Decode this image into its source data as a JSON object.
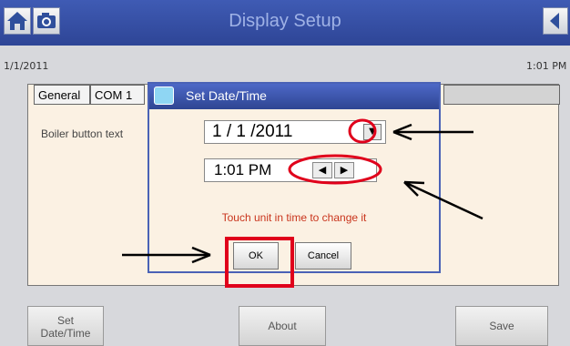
{
  "window": {
    "title": "Display Setup"
  },
  "toolbar": {
    "home_icon": "home-icon",
    "camera_icon": "camera-icon",
    "back_icon": "back-icon"
  },
  "status": {
    "date": "1/1/2011",
    "time": "1:01 PM"
  },
  "tabs": [
    {
      "label": "General"
    },
    {
      "label": "COM 1"
    }
  ],
  "panel": {
    "field_label": "Boiler button text"
  },
  "dialog": {
    "title": "Set Date/Time",
    "date_value": "1 / 1 /2011",
    "time_value": "1:01 PM",
    "hint": "Touch unit in time to change it",
    "ok_label": "OK",
    "cancel_label": "Cancel"
  },
  "bottom": {
    "set_datetime_line1": "Set",
    "set_datetime_line2": "Date/Time",
    "about_label": "About",
    "save_label": "Save"
  },
  "colors": {
    "title_bar": "#2e4596",
    "panel_bg": "#fbf1e3",
    "annotation_red": "#e0001b",
    "hint_text": "#c9341c"
  }
}
